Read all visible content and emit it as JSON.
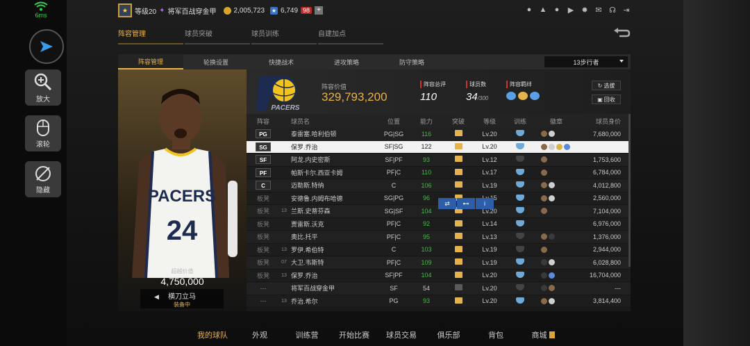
{
  "status": {
    "latency": "6ms"
  },
  "tools": [
    {
      "label": "放大",
      "icon": "zoom-in-icon"
    },
    {
      "label": "滚轮",
      "icon": "mouse-icon"
    },
    {
      "label": "隐藏",
      "icon": "hide-icon"
    }
  ],
  "user": {
    "level": "等级20",
    "name": "将军百战穿金甲",
    "coins": "2,005,723",
    "stars": "6,749",
    "tickets": "98"
  },
  "main_tabs": [
    "阵容管理",
    "球员突破",
    "球员训练",
    "自建加点"
  ],
  "sub_tabs": [
    "阵容管理",
    "轮换设置",
    "快捷战术",
    "进攻策略",
    "防守策略"
  ],
  "dropdown": "13步行者",
  "card": {
    "jersey_team": "PACERS",
    "jersey_number": "24",
    "value_label": "超越价值",
    "value": "4,750,000",
    "skill_name": "横刀立马",
    "skill_state": "装备中"
  },
  "team": {
    "logo_text": "PACERS",
    "value_label": "阵容价值",
    "value": "329,793,200",
    "rating_label": "阵容总评",
    "rating": "110",
    "count_label": "球员数",
    "count": "34",
    "count_max": "/300",
    "chem_label": "阵容羁绊",
    "btn_pick": "选拔",
    "btn_recycle": "回收"
  },
  "columns": [
    "阵容",
    "球员名",
    "位置",
    "能力",
    "突破",
    "等级",
    "训练",
    "徽章",
    "球员身价"
  ],
  "rows": [
    {
      "slot": "PG",
      "num": "",
      "name": "泰雷塞.哈利伯顿",
      "pos": "PG|SG",
      "ovr": "116",
      "lv": "Lv.20",
      "val": "7,680,000"
    },
    {
      "slot": "SG",
      "num": "",
      "name": "保罗.乔治",
      "pos": "SF|SG",
      "ovr": "122",
      "lv": "Lv.20",
      "val": "",
      "selected": true
    },
    {
      "slot": "SF",
      "num": "",
      "name": "阿龙.内史密斯",
      "pos": "SF|PF",
      "ovr": "93",
      "lv": "Lv.12",
      "val": "1,753,600"
    },
    {
      "slot": "PF",
      "num": "",
      "name": "帕斯卡尔.西亚卡姆",
      "pos": "PF|C",
      "ovr": "110",
      "lv": "Lv.17",
      "val": "6,784,000"
    },
    {
      "slot": "C",
      "num": "",
      "name": "迈勒斯.特纳",
      "pos": "C",
      "ovr": "106",
      "lv": "Lv.19",
      "val": "4,012,800"
    },
    {
      "slot": "板凳",
      "num": "",
      "name": "安德鲁.内姆布哈德",
      "pos": "SG|PG",
      "ovr": "96",
      "lv": "Lv.15",
      "val": "2,560,000"
    },
    {
      "slot": "板凳",
      "num": "13",
      "name": "兰斯.史蒂芬森",
      "pos": "SG|SF",
      "ovr": "104",
      "lv": "Lv.20",
      "val": "7,104,000"
    },
    {
      "slot": "板凳",
      "num": "",
      "name": "贾雷斯.沃克",
      "pos": "PF|C",
      "ovr": "92",
      "lv": "Lv.14",
      "val": "6,976,000"
    },
    {
      "slot": "板凳",
      "num": "",
      "name": "奥比.托平",
      "pos": "PF|C",
      "ovr": "95",
      "lv": "Lv.13",
      "val": "1,376,000"
    },
    {
      "slot": "板凳",
      "num": "13",
      "name": "罗伊.希伯特",
      "pos": "C",
      "ovr": "103",
      "lv": "Lv.19",
      "val": "2,944,000"
    },
    {
      "slot": "板凳",
      "num": "07",
      "name": "大卫.韦斯特",
      "pos": "PF|C",
      "ovr": "109",
      "lv": "Lv.19",
      "val": "6,028,800"
    },
    {
      "slot": "板凳",
      "num": "13",
      "name": "保罗.乔治",
      "pos": "SF|PF",
      "ovr": "104",
      "lv": "Lv.20",
      "val": "16,704,000"
    },
    {
      "slot": "---",
      "num": "",
      "name": "将军百战穿金甲",
      "pos": "SF",
      "ovr": "54",
      "lv": "Lv.20",
      "val": "---"
    },
    {
      "slot": "---",
      "num": "13",
      "name": "乔治.希尔",
      "pos": "PG",
      "ovr": "93",
      "lv": "Lv.20",
      "val": "3,814,400"
    }
  ],
  "bottom_nav": [
    "我的球队",
    "外观",
    "训练营",
    "开始比赛",
    "球员交易",
    "俱乐部",
    "背包",
    "商城"
  ],
  "colors": {
    "accent": "#e6b24a",
    "green": "#3fbf3f",
    "blue": "#2b5da8"
  }
}
